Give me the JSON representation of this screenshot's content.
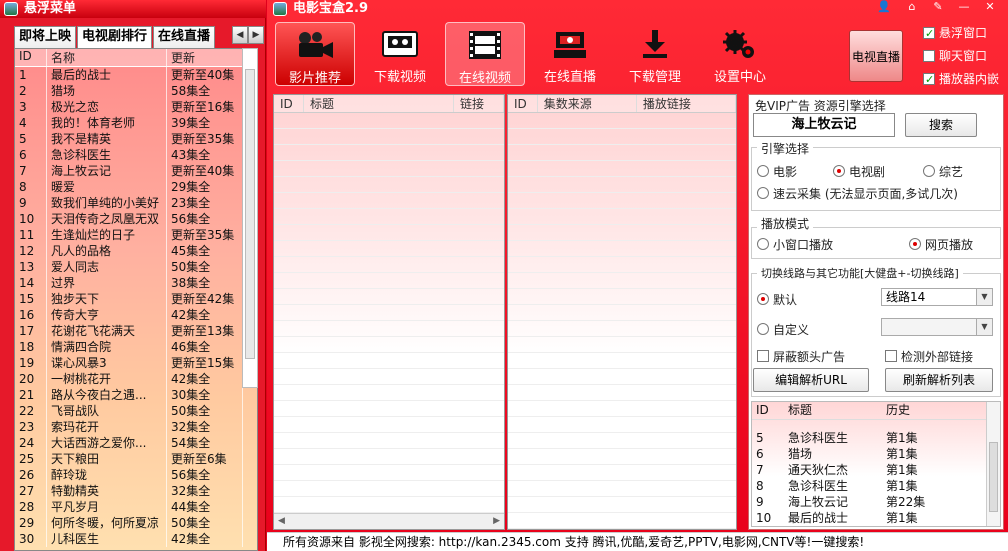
{
  "float_menu": {
    "title": "悬浮菜单",
    "tabs": [
      "即将上映",
      "电视剧排行",
      "在线直播"
    ],
    "columns": [
      "ID",
      "名称",
      "更新"
    ],
    "rows": [
      [
        "1",
        "最后的战士",
        "更新至40集"
      ],
      [
        "2",
        "猎场",
        "58集全"
      ],
      [
        "3",
        "极光之恋",
        "更新至16集"
      ],
      [
        "4",
        "我的！体育老师",
        "39集全"
      ],
      [
        "5",
        "我不是精英",
        "更新至35集"
      ],
      [
        "6",
        "急诊科医生",
        "43集全"
      ],
      [
        "7",
        "海上牧云记",
        "更新至40集"
      ],
      [
        "8",
        "暖爱",
        "29集全"
      ],
      [
        "9",
        "致我们单纯的小美好",
        "23集全"
      ],
      [
        "10",
        "天泪传奇之凤凰无双",
        "56集全"
      ],
      [
        "11",
        "生逢灿烂的日子",
        "更新至35集"
      ],
      [
        "12",
        "凡人的品格",
        "45集全"
      ],
      [
        "13",
        "爱人同志",
        "50集全"
      ],
      [
        "14",
        "过界",
        "38集全"
      ],
      [
        "15",
        "独步天下",
        "更新至42集"
      ],
      [
        "16",
        "传奇大亨",
        "42集全"
      ],
      [
        "17",
        "花谢花飞花满天",
        "更新至13集"
      ],
      [
        "18",
        "情满四合院",
        "46集全"
      ],
      [
        "19",
        "谍心风暴3",
        "更新至15集"
      ],
      [
        "20",
        "一树桃花开",
        "42集全"
      ],
      [
        "21",
        "路从今夜白之遇...",
        "30集全"
      ],
      [
        "22",
        "飞哥战队",
        "50集全"
      ],
      [
        "23",
        "索玛花开",
        "32集全"
      ],
      [
        "24",
        "大话西游之爱你...",
        "54集全"
      ],
      [
        "25",
        "天下粮田",
        "更新至6集"
      ],
      [
        "26",
        "醉玲珑",
        "56集全"
      ],
      [
        "27",
        "特勤精英",
        "32集全"
      ],
      [
        "28",
        "平凡岁月",
        "44集全"
      ],
      [
        "29",
        "何所冬暖，何所夏凉",
        "50集全"
      ],
      [
        "30",
        "儿科医生",
        "42集全"
      ]
    ]
  },
  "main": {
    "title": "电影宝盒2.9",
    "window_icons": [
      "person-icon",
      "home-icon",
      "pin-icon",
      "minimize-icon",
      "close-icon"
    ],
    "nav": [
      {
        "label": "影片推荐",
        "icon": "movie-camera-icon"
      },
      {
        "label": "下载视频",
        "icon": "video-download-icon"
      },
      {
        "label": "在线视频",
        "icon": "film-icon"
      },
      {
        "label": "在线直播",
        "icon": "broadcast-icon"
      },
      {
        "label": "下载管理",
        "icon": "download-arrow-icon"
      },
      {
        "label": "设置中心",
        "icon": "gears-icon"
      }
    ],
    "tv_live_button": "电视直播",
    "toggles": [
      {
        "label": "悬浮窗口",
        "checked": true
      },
      {
        "label": "聊天窗口",
        "checked": false
      },
      {
        "label": "播放器内嵌",
        "checked": true
      }
    ],
    "grid1_columns": [
      "ID",
      "标题",
      "链接"
    ],
    "grid2_columns": [
      "ID",
      "集数来源",
      "播放链接"
    ],
    "right_panel": {
      "header": "免VIP广告  资源引擎选择",
      "search_value": "海上牧云记",
      "search_button": "搜索",
      "engine_title": "引擎选择",
      "engines": [
        {
          "label": "电影",
          "selected": false
        },
        {
          "label": "电视剧",
          "selected": true
        },
        {
          "label": "综艺",
          "selected": false
        },
        {
          "label": "速云采集 (无法显示页面,多试几次)",
          "selected": false
        }
      ],
      "play_mode_title": "播放模式",
      "play_modes": [
        {
          "label": "小窗口播放",
          "selected": false
        },
        {
          "label": "网页播放",
          "selected": true
        }
      ],
      "line_title": "切换线路与其它功能[大健盘+-切换线路]",
      "line_default": "默认",
      "line_custom": "自定义",
      "line_value": "线路14",
      "custom_value": "",
      "block_ads": "屏蔽额头广告",
      "detect_links": "检测外部链接",
      "edit_button": "编辑解析URL",
      "refresh_button": "刷新解析列表",
      "history_columns": [
        "ID",
        "标题",
        "历史"
      ],
      "history": [
        [
          "5",
          "急诊科医生",
          "第1集"
        ],
        [
          "6",
          "猎场",
          "第1集"
        ],
        [
          "7",
          "通天狄仁杰",
          "第1集"
        ],
        [
          "8",
          "急诊科医生",
          "第1集"
        ],
        [
          "9",
          "海上牧云记",
          "第22集"
        ],
        [
          "10",
          "最后的战士",
          "第1集"
        ]
      ]
    },
    "status": "所有资源来自 影视全网搜索: http://kan.2345.com 支持 腾讯,优酷,爱奇艺,PPTV,电影网,CNTV等!一键搜索!"
  },
  "colors": {
    "accent": "#e0001c",
    "panel": "#ffffff",
    "check": "#009900"
  }
}
